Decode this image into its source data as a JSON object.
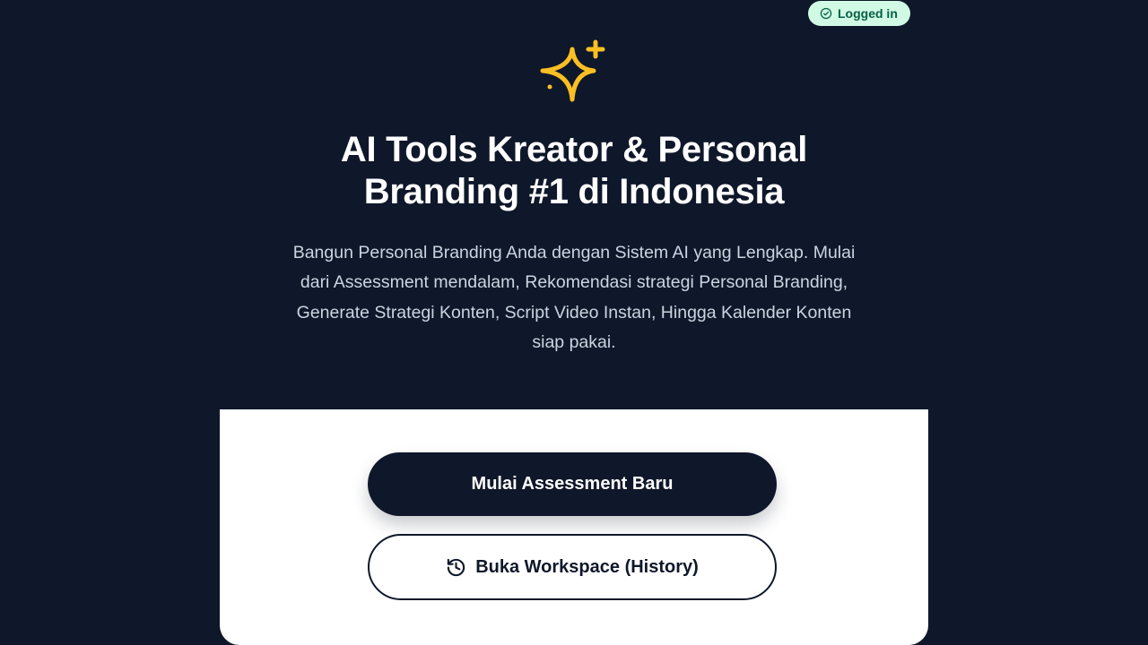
{
  "status": {
    "label": "Logged in",
    "icon": "check-circle-icon",
    "bg_color": "#d1fae5",
    "text_color": "#065f46"
  },
  "hero": {
    "icon": "sparkles-icon",
    "icon_color": "#fbbf24",
    "title": "AI Tools Kreator & Personal Branding #1 di Indonesia",
    "description": "Bangun Personal Branding Anda dengan Sistem AI yang Lengkap. Mulai dari Assessment mendalam, Rekomendasi strategi Personal Branding, Generate Strategi Konten, Script Video Instan, Hingga Kalender Konten siap pakai."
  },
  "actions": {
    "primary_label": "Mulai Assessment Baru",
    "secondary_label": "Buka Workspace (History)",
    "secondary_icon": "history-icon"
  },
  "colors": {
    "background": "#0f172a",
    "panel": "#ffffff"
  }
}
